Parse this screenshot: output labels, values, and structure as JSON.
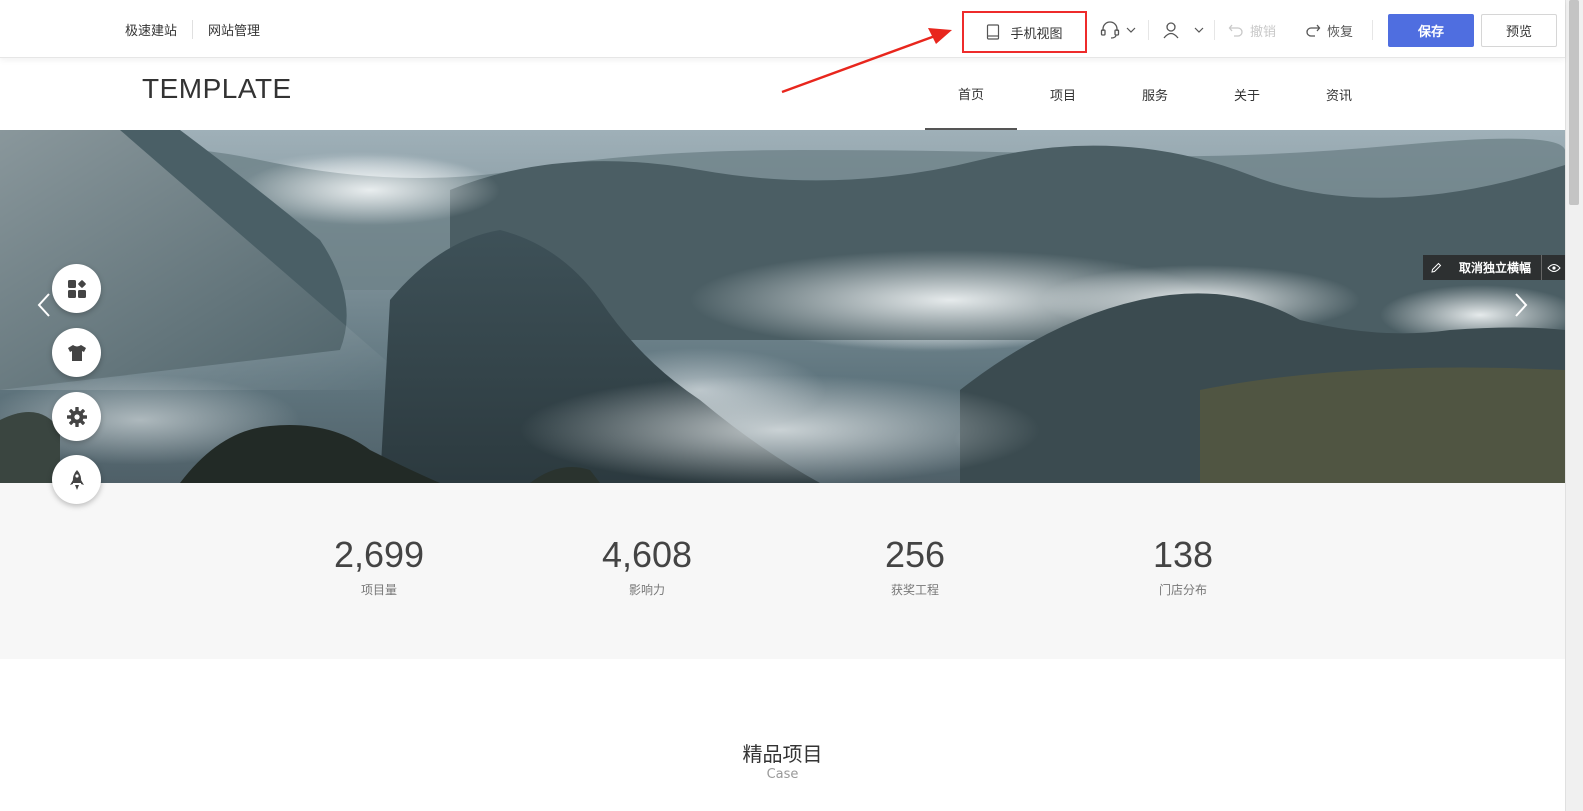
{
  "toolbar": {
    "quick_build": "极速建站",
    "site_manage": "网站管理",
    "mobile_view": "手机视图",
    "undo": "撤销",
    "redo": "恢复",
    "save": "保存",
    "preview": "预览"
  },
  "site": {
    "logo": "TEMPLATE",
    "nav": [
      "首页",
      "项目",
      "服务",
      "关于",
      "资讯"
    ],
    "active_nav": "首页"
  },
  "banner": {
    "edit_tag": "取消独立横幅"
  },
  "stats": [
    {
      "value": "2,699",
      "label": "项目量"
    },
    {
      "value": "4,608",
      "label": "影响力"
    },
    {
      "value": "256",
      "label": "获奖工程"
    },
    {
      "value": "138",
      "label": "门店分布"
    }
  ],
  "section": {
    "title": "精品项目",
    "subtitle": "Case"
  },
  "colors": {
    "accent": "#4f6ee0",
    "highlight": "#ee2b2b"
  }
}
